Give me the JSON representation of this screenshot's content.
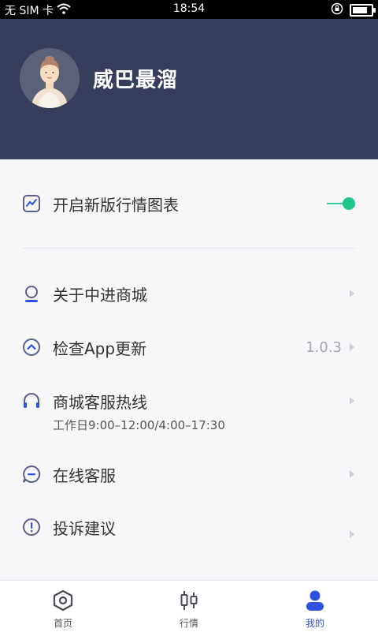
{
  "status_bar": {
    "carrier": "无 SIM 卡",
    "time": "18:54",
    "icons": [
      "wifi-icon",
      "rotation-lock-icon",
      "battery-icon"
    ]
  },
  "profile": {
    "username": "威巴最溜",
    "avatar_icon": "user-avatar"
  },
  "settings": {
    "chart_toggle": {
      "label": "开启新版行情图表",
      "enabled": true,
      "icon": "chart-icon"
    },
    "items": [
      {
        "label": "关于中进商城",
        "icon": "about-icon"
      },
      {
        "label": "检查App更新",
        "value": "1.0.3",
        "icon": "update-icon"
      },
      {
        "label": "商城客服热线",
        "sub": "工作日9:00–12:00/4:00–17:30",
        "icon": "headset-icon"
      },
      {
        "label": "在线客服",
        "icon": "chat-icon"
      },
      {
        "label": "投诉建议",
        "icon": "alert-icon"
      }
    ]
  },
  "tabbar": {
    "tabs": [
      {
        "label": "首页",
        "icon": "home-icon",
        "active": false
      },
      {
        "label": "行情",
        "icon": "candlestick-icon",
        "active": false
      },
      {
        "label": "我的",
        "icon": "profile-icon",
        "active": true
      }
    ],
    "active_color": "#2f52e0"
  },
  "colors": {
    "header_bg": "#363e5b",
    "toggle_on": "#20c689",
    "icon_color": "#5b6089"
  }
}
